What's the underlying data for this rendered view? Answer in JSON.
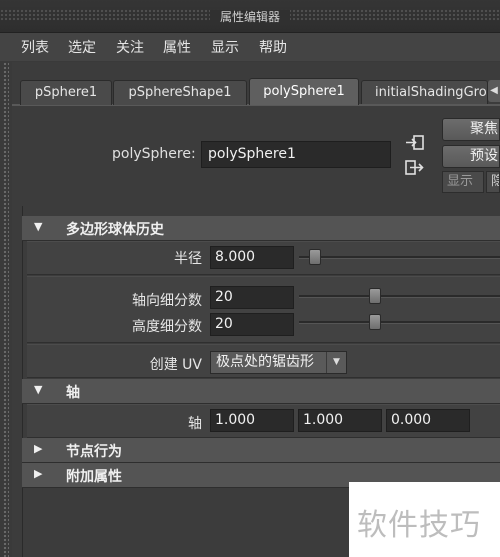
{
  "window": {
    "title": "属性编辑器"
  },
  "menu": [
    "列表",
    "选定",
    "关注",
    "属性",
    "显示",
    "帮助"
  ],
  "tabs": [
    {
      "label": "pSphere1",
      "active": false
    },
    {
      "label": "pSphereShape1",
      "active": false
    },
    {
      "label": "polySphere1",
      "active": true
    },
    {
      "label": "initialShadingGroup",
      "active": false
    }
  ],
  "node": {
    "label": "polySphere:",
    "value": "polySphere1"
  },
  "right_buttons": {
    "focus": "聚焦",
    "presets": "预设",
    "show": "显示",
    "hide": "隐藏"
  },
  "sections": {
    "history": {
      "title": "多边形球体历史",
      "radius": {
        "label": "半径",
        "value": "8.000",
        "slider_fraction": 0.05
      },
      "subdiv_axis": {
        "label": "轴向细分数",
        "value": "20",
        "slider_fraction": 0.37
      },
      "subdiv_height": {
        "label": "高度细分数",
        "value": "20",
        "slider_fraction": 0.37
      },
      "create_uv": {
        "label": "创建 UV",
        "value": "极点处的锯齿形"
      }
    },
    "axis": {
      "title": "轴",
      "label": "轴",
      "values": [
        "1.000",
        "1.000",
        "0.000"
      ]
    },
    "node_behavior": {
      "title": "节点行为"
    },
    "extra_attrs": {
      "title": "附加属性"
    }
  },
  "watermark": "软件技巧",
  "colors": {
    "background": "#3a3a3a",
    "section_header": "#545454",
    "field": "#2a2a2a"
  }
}
